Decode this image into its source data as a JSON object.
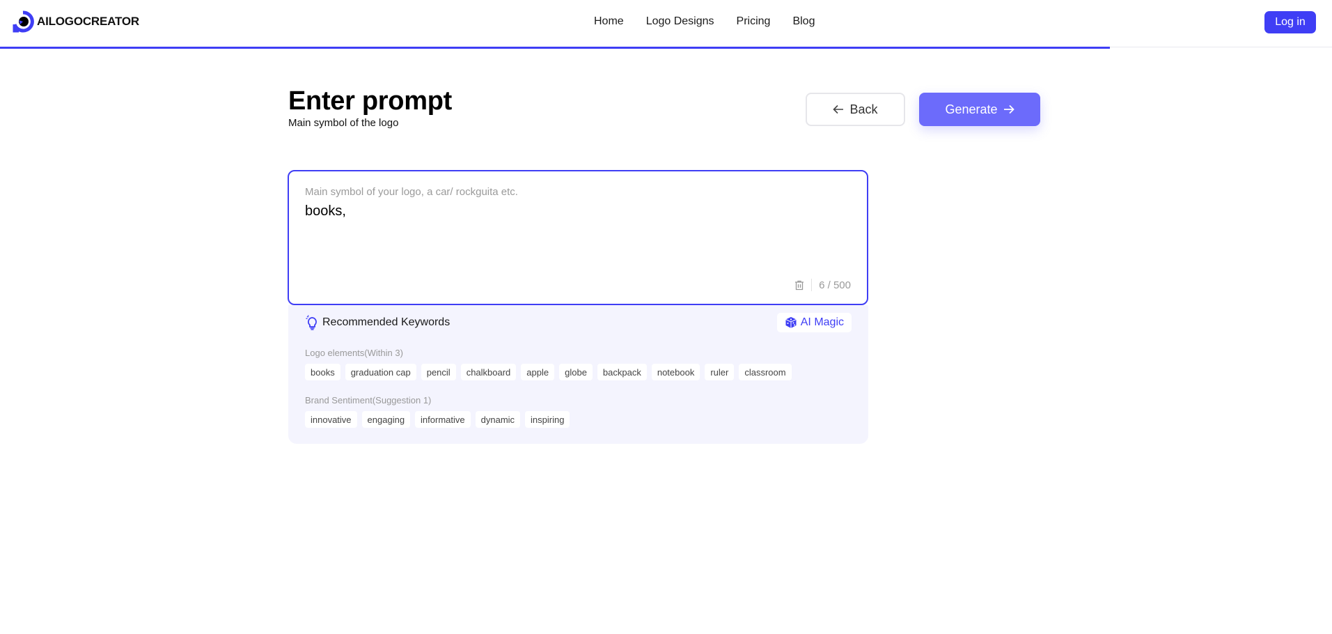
{
  "header": {
    "brand": "AILOGOCREATOR",
    "nav": [
      {
        "label": "Home"
      },
      {
        "label": "Logo Designs"
      },
      {
        "label": "Pricing"
      },
      {
        "label": "Blog"
      }
    ],
    "login_label": "Log in",
    "progress_fraction": 0.833
  },
  "page": {
    "title": "Enter prompt",
    "subtitle": "Main symbol of the logo",
    "back_label": "Back",
    "generate_label": "Generate"
  },
  "prompt": {
    "label": "Main symbol of your logo, a car/ rockguita etc.",
    "value": "books,",
    "counter": "6 / 500"
  },
  "keywords": {
    "heading": "Recommended Keywords",
    "ai_magic_label": "AI Magic",
    "groups": [
      {
        "label": "Logo elements(Within 3)",
        "items": [
          "books",
          "graduation cap",
          "pencil",
          "chalkboard",
          "apple",
          "globe",
          "backpack",
          "notebook",
          "ruler",
          "classroom"
        ]
      },
      {
        "label": "Brand Sentiment(Suggestion 1)",
        "items": [
          "innovative",
          "engaging",
          "informative",
          "dynamic",
          "inspiring"
        ]
      }
    ]
  },
  "colors": {
    "accent": "#3f3ef5",
    "generate": "#6c6bfb",
    "panel_bg": "#f4f4fe"
  }
}
